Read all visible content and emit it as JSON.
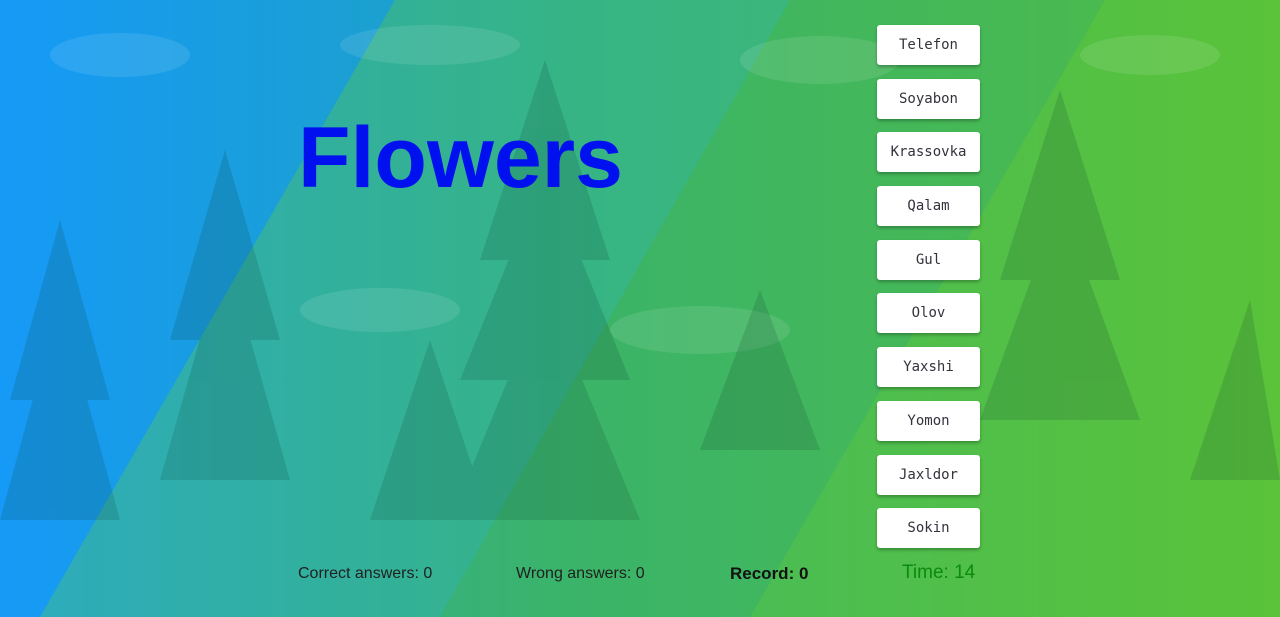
{
  "colors": {
    "background_left": "#1aa0ff",
    "background_mid": "#2fb47e",
    "background_right": "#58c43a",
    "word": "#0010ee",
    "timer": "#0b8a0b"
  },
  "question": {
    "word": "Flowers"
  },
  "answers": [
    {
      "label": "Telefon"
    },
    {
      "label": "Soyabon"
    },
    {
      "label": "Krassovka"
    },
    {
      "label": "Qalam"
    },
    {
      "label": "Gul"
    },
    {
      "label": "Olov"
    },
    {
      "label": "Yaxshi"
    },
    {
      "label": "Yomon"
    },
    {
      "label": "Jaxldor"
    },
    {
      "label": "Sokin"
    }
  ],
  "stats": {
    "correct": "Correct answers: 0",
    "wrong": "Wrong answers: 0",
    "record": "Record: 0",
    "time": "Time: 14"
  }
}
